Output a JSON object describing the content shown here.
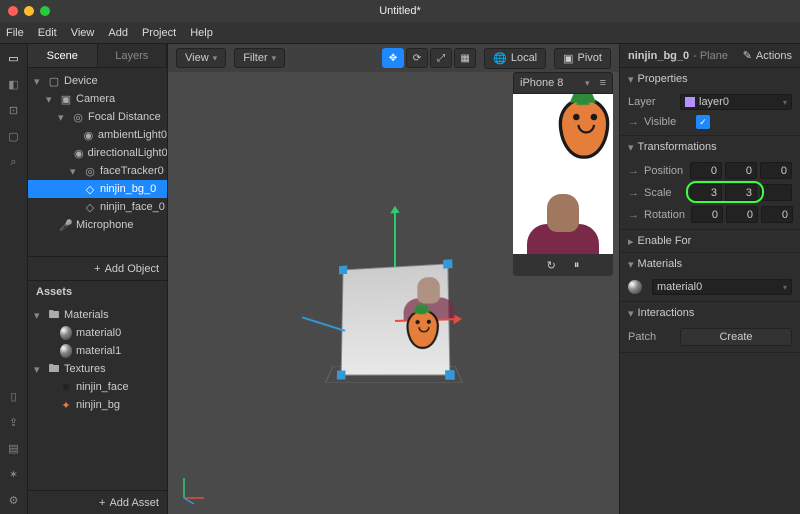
{
  "window": {
    "title": "Untitled*"
  },
  "menubar": [
    "File",
    "Edit",
    "View",
    "Add",
    "Project",
    "Help"
  ],
  "leftrail_top_icons": [
    "cursor",
    "cube",
    "null-obj",
    "rect",
    "search"
  ],
  "leftrail_bottom_icons": [
    "phone",
    "export",
    "library",
    "test",
    "settings"
  ],
  "scene_panel": {
    "tabs": {
      "scene": "Scene",
      "layers": "Layers"
    },
    "tree": [
      {
        "depth": 1,
        "label": "Device",
        "icon": "device",
        "expanded": true
      },
      {
        "depth": 2,
        "label": "Camera",
        "icon": "camera",
        "expanded": true
      },
      {
        "depth": 3,
        "label": "Focal Distance",
        "icon": "focal",
        "expanded": true
      },
      {
        "depth": 4,
        "label": "ambientLight0",
        "icon": "light"
      },
      {
        "depth": 4,
        "label": "directionalLight0",
        "icon": "light"
      },
      {
        "depth": 4,
        "label": "faceTracker0",
        "icon": "tracker",
        "expanded": true
      },
      {
        "depth": 4,
        "label": "ninjin_bg_0",
        "icon": "plane",
        "selected": true
      },
      {
        "depth": 4,
        "label": "ninjin_face_0",
        "icon": "plane"
      },
      {
        "depth": 2,
        "label": "Microphone",
        "icon": "mic"
      }
    ],
    "add_object": "Add Object"
  },
  "assets_panel": {
    "title": "Assets",
    "tree": [
      {
        "depth": 1,
        "label": "Materials",
        "icon": "folder",
        "expanded": true
      },
      {
        "depth": 2,
        "label": "material0",
        "icon": "material"
      },
      {
        "depth": 2,
        "label": "material1",
        "icon": "material"
      },
      {
        "depth": 1,
        "label": "Textures",
        "icon": "folder",
        "expanded": true
      },
      {
        "depth": 2,
        "label": "ninjin_face",
        "icon": "tex-dark"
      },
      {
        "depth": 2,
        "label": "ninjin_bg",
        "icon": "tex-orange"
      }
    ],
    "add_asset": "Add Asset"
  },
  "viewport": {
    "view_btn": "View",
    "filter_btn": "Filter",
    "toolbar_mid": [
      "move",
      "rotate",
      "scale",
      "snap"
    ],
    "world_local": "Local",
    "pivot": "Pivot",
    "preview_device": "iPhone 8",
    "preview_ctrls": [
      "refresh",
      "pause"
    ]
  },
  "inspector": {
    "object_name": "ninjin_bg_0",
    "object_type": "- Plane",
    "actions_label": "Actions",
    "sections": {
      "properties": {
        "title": "Properties",
        "layer_label": "Layer",
        "layer_value": "layer0",
        "visible_label": "Visible",
        "visible": true
      },
      "transforms": {
        "title": "Transformations",
        "position_label": "Position",
        "position": [
          "0",
          "0",
          "0"
        ],
        "scale_label": "Scale",
        "scale": [
          "3",
          "3",
          ""
        ],
        "rotation_label": "Rotation",
        "rotation": [
          "0",
          "0",
          "0"
        ]
      },
      "enable_for": {
        "title": "Enable For"
      },
      "materials": {
        "title": "Materials",
        "items": [
          "material0"
        ]
      },
      "interactions": {
        "title": "Interactions",
        "patch_label": "Patch",
        "create_label": "Create"
      }
    }
  }
}
